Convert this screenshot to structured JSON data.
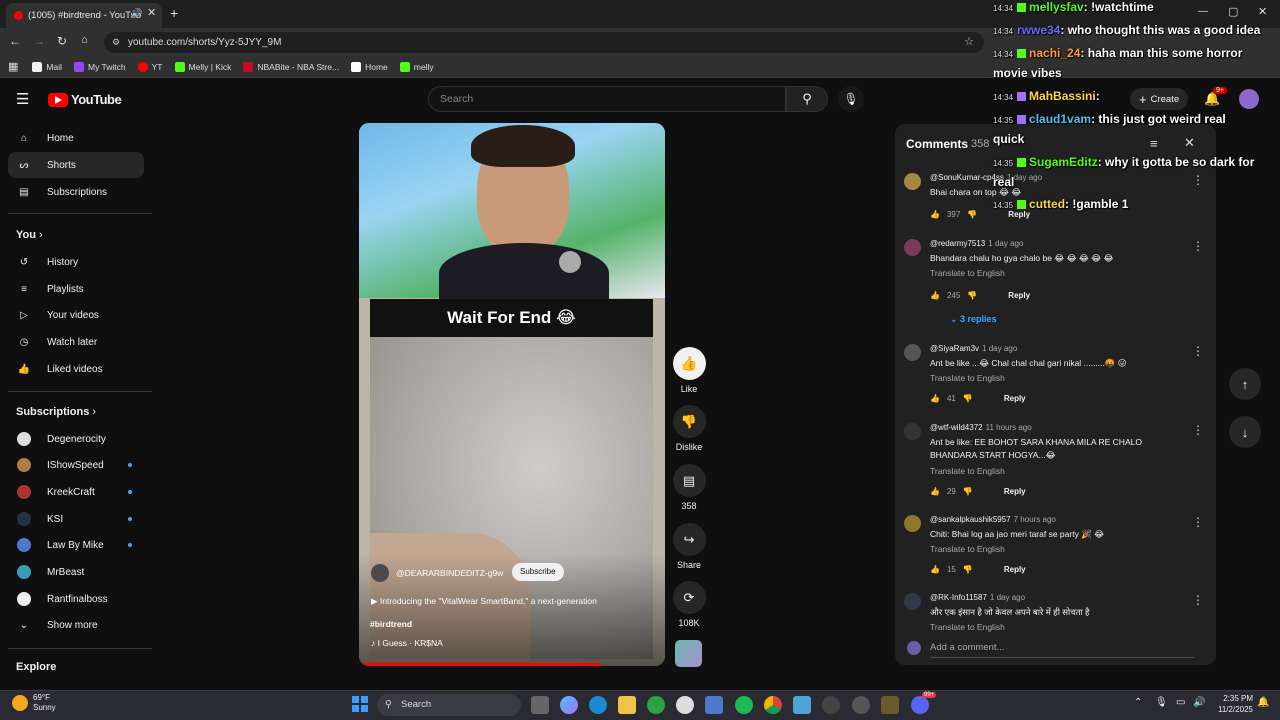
{
  "browser": {
    "tab_title": "(1005) #birdtrend - YouTub",
    "url": "youtube.com/shorts/Yyz-5JYY_9M",
    "bookmarks": [
      {
        "label": "Mail",
        "color": "#f1f1f1"
      },
      {
        "label": "My Twitch",
        "color": "#9146ff"
      },
      {
        "label": "YT",
        "color": "#ff0000"
      },
      {
        "label": "Melly | Kick",
        "color": "#53fc18"
      },
      {
        "label": "NBABite - NBA Stre...",
        "color": "#c9082a"
      },
      {
        "label": "Home",
        "color": "#ffffff"
      },
      {
        "label": "melly",
        "color": "#53fc18"
      }
    ]
  },
  "youtube": {
    "logo": "YouTube",
    "search_placeholder": "Search",
    "create_label": "Create",
    "notif_count": "9+",
    "sidebar": {
      "main": [
        "Home",
        "Shorts",
        "Subscriptions"
      ],
      "you_header": "You",
      "you_items": [
        "History",
        "Playlists",
        "Your videos",
        "Watch later",
        "Liked videos"
      ],
      "subs_header": "Subscriptions",
      "subs": [
        "Degenerocity",
        "IShowSpeed",
        "KreekCraft",
        "KSI",
        "Law By Mike",
        "MrBeast",
        "Rantfinalboss"
      ],
      "show_more": "Show more",
      "explore": "Explore"
    }
  },
  "short": {
    "caption": "Wait For End 😂",
    "channel": "@DEARARBINDEDITZ-g9w",
    "subscribe": "Subscribe",
    "description": "Introducing the \"VitalWear SmartBand,\" a next-generation",
    "hashtag": "#birdtrend",
    "music": "I Guess · KR$NA",
    "progress_fraction": 0.79,
    "actions": {
      "like": "Like",
      "dislike": "Dislike",
      "comments": "358",
      "share": "Share",
      "remix": "108K"
    }
  },
  "comments_panel": {
    "title": "Comments",
    "count": "358",
    "replies_label": "3 replies",
    "add_placeholder": "Add a comment...",
    "items": [
      {
        "user": "@SonuKumar-cp4ss",
        "ago": "1 day ago",
        "text": "Bhai chara on top 😂 😂",
        "translate": "",
        "likes": "397",
        "reply": "Reply",
        "avatar": "#a08a40"
      },
      {
        "user": "@redarmy7513",
        "ago": "1 day ago",
        "text": "Bhandara chalu ho gya chalo be 😂 😂 😂 😂 😂",
        "translate": "Translate to English",
        "likes": "245",
        "reply": "Reply",
        "avatar": "#7a3a5a"
      },
      {
        "user": "@SiyaRam3v",
        "ago": "1 day ago",
        "text": "Ant be like ...😂  Chal chal chal gari nikal .........🤬 😛",
        "translate": "Translate to English",
        "likes": "41",
        "reply": "Reply",
        "avatar": "#555"
      },
      {
        "user": "@wtf-wild4372",
        "ago": "11 hours ago",
        "text": "Ant be like: EE BOHOT SARA KHANA MILA RE CHALO BHANDARA START HOGYA...😂",
        "translate": "Translate to English",
        "likes": "29",
        "reply": "Reply",
        "avatar": "#333"
      },
      {
        "user": "@sankalpkaushik5957",
        "ago": "7 hours ago",
        "text": "Chiti: Bhai log aa jao meri taraf se party 🎉 😂",
        "translate": "Translate to English",
        "likes": "15",
        "reply": "Reply",
        "avatar": "#8a7a2a"
      },
      {
        "user": "@RK-Info11587",
        "ago": "1 day ago",
        "text": "और एक इंसान है जो केवल अपने बारे में ही सोचता है",
        "translate": "Translate to English",
        "likes": "",
        "reply": "",
        "avatar": "#2a3a4a"
      }
    ]
  },
  "chat": [
    {
      "time": "14:34",
      "user": "mellysfav",
      "msg": ": !watchtime",
      "color": "#53fc18"
    },
    {
      "time": "14:34",
      "user": "rwwe34",
      "msg": ": who thought this was a good idea",
      "color": "#6a6aff"
    },
    {
      "time": "14:34",
      "user": "nachi_24",
      "msg": ": haha man this some horror",
      "color": "#ff9e3a"
    },
    {
      "time": "",
      "user": "",
      "msg": "movie vibes",
      "color": "#ffffff"
    },
    {
      "time": "14:34",
      "user": "MahBassini",
      "msg": ":",
      "color": "#ffd54a"
    },
    {
      "time": "14:35",
      "user": "claud1vam",
      "msg": ": this just got weird real",
      "color": "#4fc3f7"
    },
    {
      "time": "",
      "user": "",
      "msg": "quick",
      "color": "#ffffff"
    },
    {
      "time": "14:35",
      "user": "SugamEditz",
      "msg": ": why it gotta be so dark for",
      "color": "#53fc18"
    },
    {
      "time": "",
      "user": "",
      "msg": "real",
      "color": "#ffffff"
    },
    {
      "time": "14:35",
      "user": "cutted",
      "msg": ": !gamble 1",
      "color": "#ffd54a"
    }
  ],
  "taskbar": {
    "weather_temp": "69°F",
    "weather_desc": "Sunny",
    "search": "Search",
    "time": "2:35 PM",
    "date": "11/2/2025",
    "badge": "99+"
  }
}
